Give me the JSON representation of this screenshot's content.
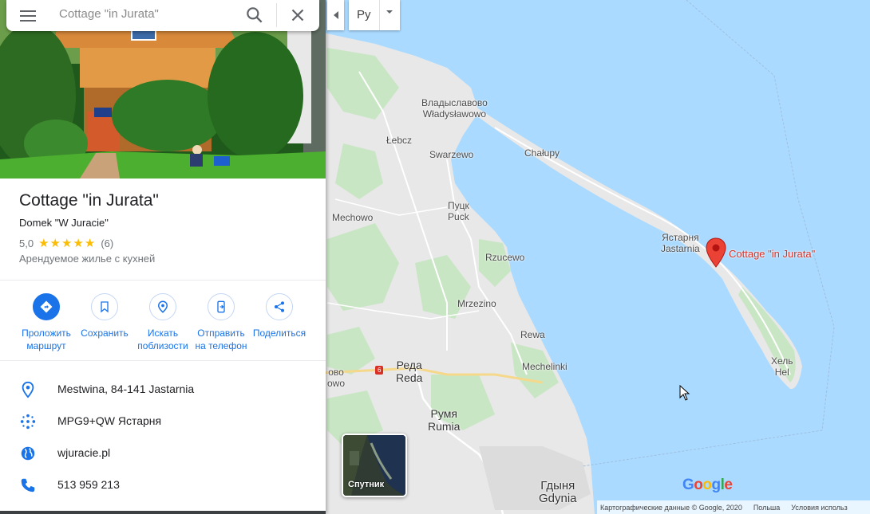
{
  "search": {
    "placeholder": "Cottage \"in Jurata\""
  },
  "place": {
    "title": "Cottage \"in Jurata\"",
    "subtitle": "Domek \"W Juracie\"",
    "rating": "5,0",
    "stars": "★★★★★",
    "reviews": "(6)",
    "category": "Арендуемое жилье с кухней"
  },
  "actions": [
    {
      "label1": "Проложить",
      "label2": "маршрут",
      "icon": "directions-icon"
    },
    {
      "label1": "Сохранить",
      "label2": "",
      "icon": "bookmark-icon"
    },
    {
      "label1": "Искать",
      "label2": "поблизости",
      "icon": "nearby-icon"
    },
    {
      "label1": "Отправить",
      "label2": "на телефон",
      "icon": "send-to-phone-icon"
    },
    {
      "label1": "Поделиться",
      "label2": "",
      "icon": "share-icon"
    }
  ],
  "info": {
    "address": "Mestwina, 84-141 Jastarnia",
    "pluscode": "MPG9+QW Ястарня",
    "website": "wjuracie.pl",
    "phone": "513 959 213"
  },
  "map": {
    "layer_label": "Pу",
    "satellite_label": "Спутник",
    "pin_label": "Cottage \"in Jurata\"",
    "road_number": "6",
    "labels": {
      "wladyslawowo": "Владыславово\nWładysławowo",
      "lebcz": "Łebcz",
      "swarzewo": "Swarzewo",
      "chalupy": "Chałupy",
      "puck": "Пуцк\nPuck",
      "mechowo": "Mechowo",
      "jastarnia": "Ястарня\nJastarnia",
      "rzucewo": "Rzucewo",
      "mrzezino": "Mrzezino",
      "rewa": "Rewa",
      "mechelinki": "Mechelinki",
      "hel": "Хель\nHel",
      "reda": "Реда\nReda",
      "wejherowo": "ово\nowo",
      "rumia": "Румя\nRumia",
      "gdynia": "Гдыня\nGdynia"
    },
    "attribution": [
      "Картографические данные © Google, 2020",
      "Польша",
      "Условия использ"
    ],
    "google_logo": "Google",
    "colors": {
      "water": "#aadaff",
      "land": "#e8e8e8",
      "green": "#c9e6c4",
      "pin": "#ea4335",
      "accent": "#1a73e8"
    }
  }
}
